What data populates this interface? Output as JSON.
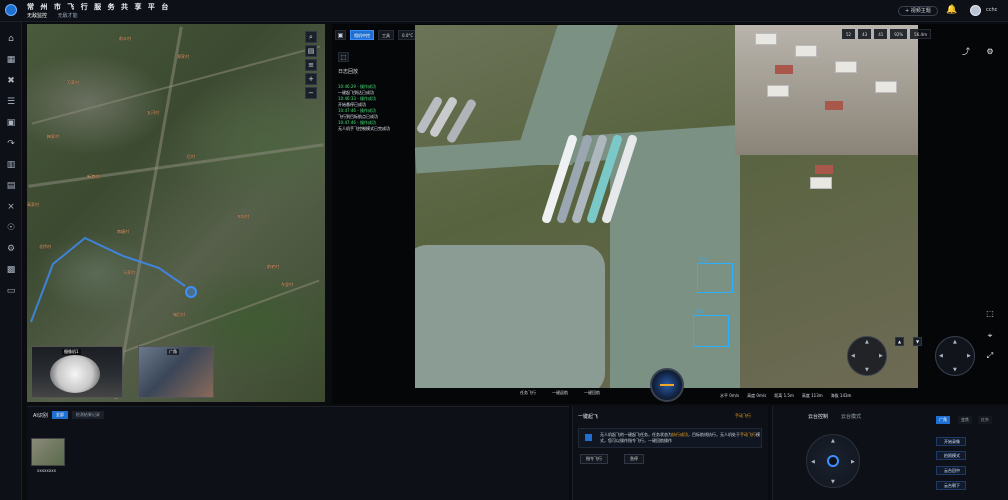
{
  "header": {
    "title": "常 州 市 飞 行 服 务 共 享 平 台",
    "subnav": [
      "无敌监控",
      "无敌才能"
    ],
    "active_subnav": 0,
    "action_button": "+ 视频主题",
    "user": "cchc"
  },
  "rail_icons": [
    "home-icon",
    "grid-icon",
    "network-icon",
    "list-icon",
    "apps-icon",
    "route-icon",
    "building-icon",
    "calendar-icon",
    "tower-icon",
    "antenna-icon",
    "gear-icon",
    "chart-icon",
    "folder-icon"
  ],
  "map": {
    "labels": [
      "前丰村",
      "郑家村",
      "万家村",
      "五河村",
      "梅家村",
      "后村",
      "新港村",
      "高家村",
      "东坝村",
      "南塘村",
      "北桥村",
      "马家村",
      "前宅村",
      "城后村",
      "东里村"
    ],
    "tools": [
      "search",
      "layers",
      "stack",
      "plus",
      "minus"
    ],
    "thumb_a_label": "摄像机1",
    "thumb_b_label": "广角"
  },
  "video": {
    "toolbar": [
      "相机中控",
      "工具",
      "0.0°C",
      "36.5°C",
      "1.5m/s",
      "360km/s"
    ],
    "log_title": "日志回放",
    "logs": [
      {
        "text": "10:46:29 - 操作成功",
        "green": true
      },
      {
        "text": "一键起飞到达已成功",
        "green": false
      },
      {
        "text": "10:46:33 - 操作成功",
        "green": true
      },
      {
        "text": "开始悬停已成功",
        "green": false
      },
      {
        "text": "10:47:46 - 操作成功",
        "green": true
      },
      {
        "text": "飞行到目标航点已成功",
        "green": false
      },
      {
        "text": "10:47:46 - 操作成功",
        "green": true
      },
      {
        "text": "无人机手飞控制模式已完成功",
        "green": false
      }
    ],
    "stats": [
      "52",
      "43",
      "41",
      "92%",
      "56.4m"
    ],
    "bottom_controls": [
      "任务飞行",
      "一键返航",
      "一键回航"
    ],
    "telemetry": [
      "水平 0m/s",
      "高度 0m/s",
      "距离 1.5m",
      "高度 113m",
      "海拔 143m"
    ],
    "detect_labels": [
      "目标",
      "目标"
    ]
  },
  "ai": {
    "title": "AI识别",
    "tabs": [
      "全部",
      "检测结果记录"
    ],
    "caption": "xxxxxxxx"
  },
  "task": {
    "title": "一键起飞",
    "link": "手动飞行",
    "text_1": "无人机起飞的一键起飞任务，任务状态为",
    "text_hl_1": "执行成功",
    "text_2": "，目标航线执行，无人机处于",
    "text_hl_2": "手动飞行",
    "text_3": "模式，您可以操作指令飞行，一键回航操作",
    "buttons": [
      "指令飞行",
      "急停"
    ]
  },
  "gimbal": {
    "tabs": [
      "云台控制",
      "云台模式"
    ],
    "modes": [
      "广角",
      "变焦",
      "红外"
    ],
    "buttons": [
      "开始录像",
      "拍照模式",
      "云台回中",
      "云台朝下"
    ]
  }
}
